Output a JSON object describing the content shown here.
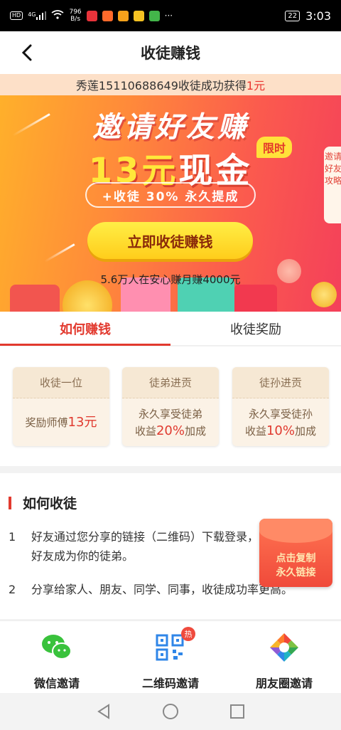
{
  "status_bar": {
    "net_label": "HD",
    "signal": "4G",
    "speed_value": "796",
    "speed_unit": "B/s",
    "more": "···",
    "battery": "22",
    "time": "3:03"
  },
  "header": {
    "title": "收徒赚钱",
    "back_icon": "chevron-left-icon"
  },
  "banner": {
    "ticker_prefix": "秀莲15110688649收徒成功获得",
    "ticker_amount": "1元",
    "headline": "邀请好友赚",
    "amount_value": "13元",
    "amount_suffix": "现金",
    "limit_badge": "限时",
    "pill_text": "+收徒 30% 永久提成",
    "cta_label": "立即收徒赚钱",
    "stat_text": "5.6万人在安心赚月赚4000元",
    "side_tab": "邀请好友攻略"
  },
  "tabs": [
    {
      "label": "如何赚钱",
      "active": true
    },
    {
      "label": "收徒奖励",
      "active": false
    }
  ],
  "cards": [
    {
      "top": "收徒一位",
      "line1": "奖励师傅",
      "highlight": "13元",
      "line2": ""
    },
    {
      "top": "徒弟进贡",
      "line1": "永久享受徒弟",
      "highlight": "20%",
      "line2": "收益",
      "suffix": "加成"
    },
    {
      "top": "徒孙进贡",
      "line1": "永久享受徒孙",
      "highlight": "10%",
      "line2": "收益",
      "suffix": "加成"
    }
  ],
  "how": {
    "title": "如何收徒",
    "steps": [
      {
        "num": "1",
        "text": "好友通过您分享的链接（二维码）下载登录，好友成为你的徒弟。"
      },
      {
        "num": "2",
        "text": "分享给家人、朋友、同学、同事，收徒成功率更高。"
      }
    ],
    "float_button": "点击复制永久链接"
  },
  "share": [
    {
      "label": "微信邀请",
      "icon": "wechat-icon"
    },
    {
      "label": "二维码邀请",
      "icon": "qrcode-icon",
      "badge": "热"
    },
    {
      "label": "朋友圈邀请",
      "icon": "moments-icon"
    }
  ],
  "colors": {
    "accent": "#e23a2f",
    "banner_start": "#ffb12a",
    "banner_end": "#f4405a",
    "cta": "#ffd62a",
    "wechat": "#39c23c"
  }
}
